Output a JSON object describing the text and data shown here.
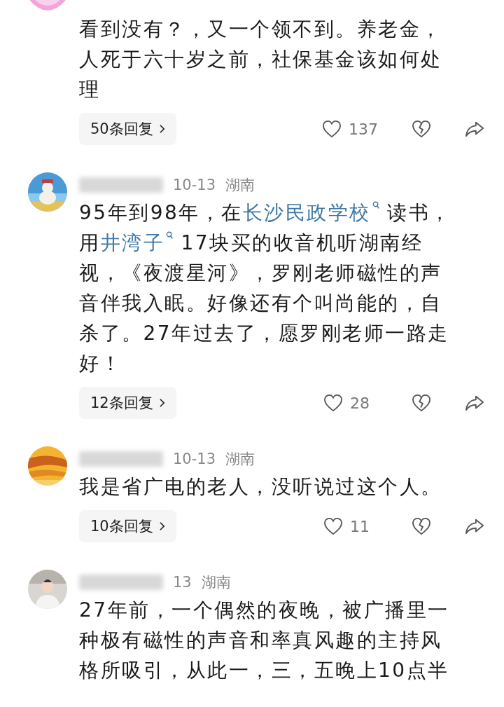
{
  "comments": [
    {
      "avatar": {
        "kind": "picture"
      },
      "body_lines": [
        [
          {
            "kind": "plain",
            "text": "看到没有？，又一个领不到。养老金，"
          }
        ],
        [
          {
            "kind": "plain",
            "text": "人死于六十岁之前，社保基金该如何处"
          }
        ],
        [
          {
            "kind": "plain",
            "text": "理"
          }
        ]
      ],
      "replies": "50条回复",
      "likes": "137"
    },
    {
      "avatar": {
        "kind": "picture"
      },
      "meta": {
        "date": "10-13",
        "region": "湖南"
      },
      "body_lines": [
        [
          {
            "kind": "plain",
            "text": "95年到98年，在"
          },
          {
            "kind": "link",
            "text": "长沙民政学校"
          },
          {
            "kind": "plain",
            "text": " 读书，"
          }
        ],
        [
          {
            "kind": "plain",
            "text": "用"
          },
          {
            "kind": "link",
            "text": "井湾子"
          },
          {
            "kind": "plain",
            "text": " 17块买的收音机听湖南经"
          }
        ],
        [
          {
            "kind": "plain",
            "text": "视，《夜渡星河》，罗刚老师磁性的声"
          }
        ],
        [
          {
            "kind": "plain",
            "text": "音伴我入眠。好像还有个叫尚能的，自"
          }
        ],
        [
          {
            "kind": "plain",
            "text": "杀了。27年过去了，愿罗刚老师一路走"
          }
        ],
        [
          {
            "kind": "plain",
            "text": "好！"
          }
        ]
      ],
      "replies": "12条回复",
      "likes": "28"
    },
    {
      "avatar": {
        "kind": "picture"
      },
      "meta": {
        "date": "10-13",
        "region": "湖南"
      },
      "body_lines": [
        [
          {
            "kind": "plain",
            "text": "我是省广电的老人，没听说过这个人。"
          }
        ]
      ],
      "replies": "10条回复",
      "likes": "11"
    },
    {
      "avatar": {
        "kind": "picture"
      },
      "meta": {
        "date": "13",
        "region": "湖南"
      },
      "body_lines": [
        [
          {
            "kind": "plain",
            "text": "27年前，一个偶然的夜晚，被广播里一"
          }
        ],
        [
          {
            "kind": "plain",
            "text": "种极有磁性的声音和率真风趣的主持风"
          }
        ],
        [
          {
            "kind": "plain",
            "text": "格所吸引，从此一，三，五晚上10点半"
          }
        ]
      ]
    }
  ]
}
